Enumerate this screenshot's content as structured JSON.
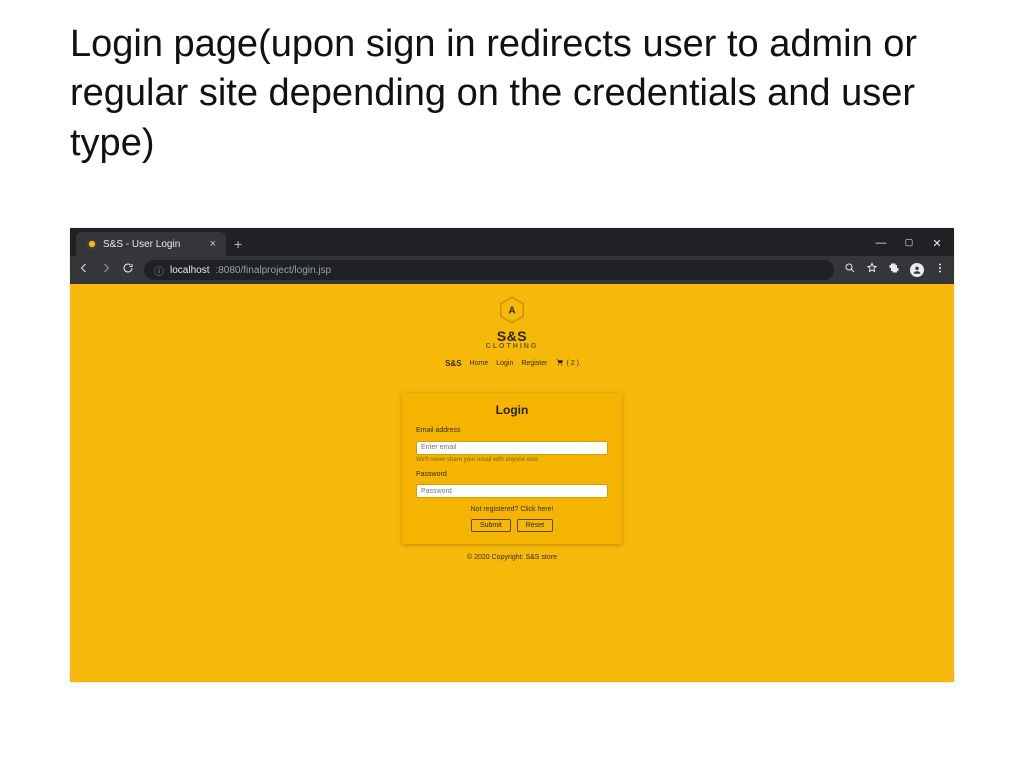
{
  "slide": {
    "title": "Login page(upon sign in redirects user to admin or regular site depending on the credentials and user type)"
  },
  "browser": {
    "tab_title": "S&S - User Login",
    "url_info_prefix": "ⓘ",
    "url_host": "localhost",
    "url_port_path": ":8080/finalproject/login.jsp"
  },
  "site": {
    "brand_top": "S&S",
    "brand_bottom": "CLOTHING",
    "nav": {
      "brand": "S&S",
      "home": "Home",
      "login": "Login",
      "register": "Register",
      "cart_count": "( 2 )"
    },
    "panel_title": "Login",
    "email_label": "Email address",
    "email_placeholder": "Enter email",
    "email_hint": "We'll never share your email with anyone else.",
    "password_label": "Password",
    "password_placeholder": "Password",
    "not_registered": "Not registered? Click here!",
    "submit": "Submit",
    "reset": "Reset",
    "copyright": "© 2020 Copyright: S&S store"
  }
}
